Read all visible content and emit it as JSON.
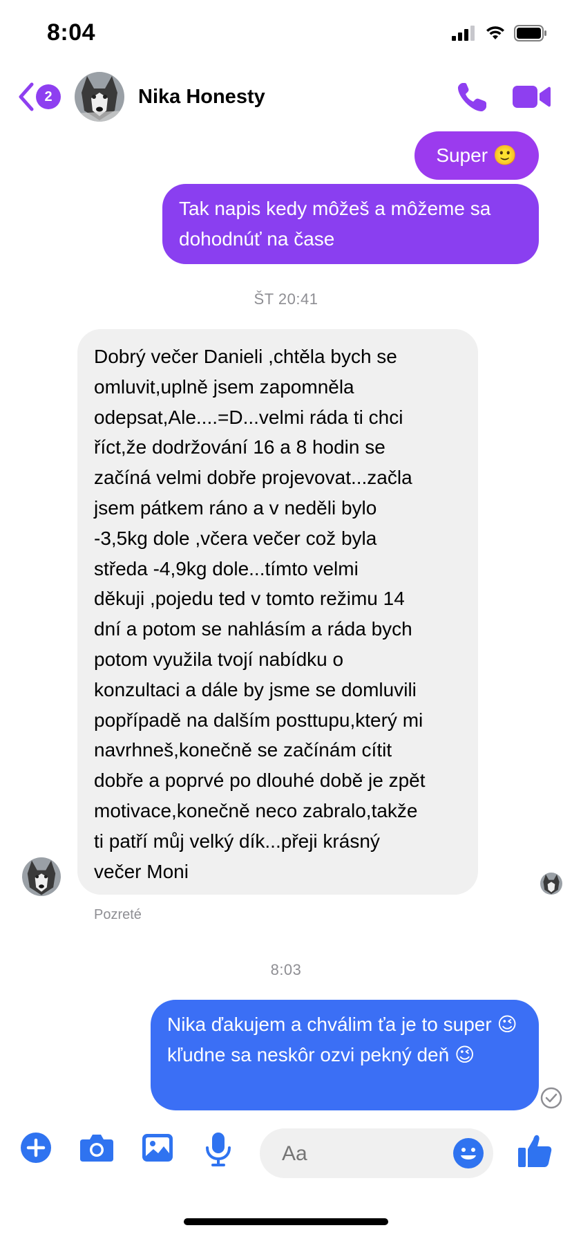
{
  "status_bar": {
    "time": "8:04"
  },
  "header": {
    "unread_count": "2",
    "contact_name": "Nika Honesty"
  },
  "messages": {
    "out_1": "Super 🙂",
    "out_2": "Tak napis kedy môžeš a môžeme sa dohodnúť na čase",
    "timestamp_1": "ŠT 20:41",
    "in_1_lines": [
      "Dobrý večer Danieli ,chtěla bych se",
      "omluvit,uplně jsem zapomněla",
      "odepsat,Ale....=D...velmi ráda ti chci",
      "říct,že dodržování 16 a 8 hodin se",
      "začíná velmi dobře projevovat...začla",
      "jsem pátkem ráno a v neděli bylo",
      "-3,5kg dole ,včera večer což byla",
      "středa -4,9kg dole...tímto velmi",
      "děkuji ,pojedu ted v tomto   režimu 14",
      "dní a potom se nahlásím a ráda bych",
      "potom využila tvojí nabídku o",
      "konzultaci a dále by  jsme se domluvili",
      "popřípadě na dalším posttupu,který mi",
      "navrhneš,konečně se začínám cítit",
      "dobře a poprvé po dlouhé době je zpět",
      "motivace,konečně neco zabralo,takže",
      "ti patří můj velký dík...přeji krásný",
      "večer Moni"
    ],
    "seen_label": "Pozreté",
    "timestamp_2": "8:03",
    "out_3": "Nika ďakujem a chválim ťa je to super 😉 kľudne sa neskôr ozvi pekný deň 😉"
  },
  "composer": {
    "placeholder": "Aa"
  },
  "colors": {
    "accent": "#8e3ff0",
    "outgoing_purple": "#8a3ff0",
    "outgoing_blue": "#3b6ff5",
    "incoming_bg": "#f0f0f0",
    "toolbar_blue": "#2f73f0"
  }
}
